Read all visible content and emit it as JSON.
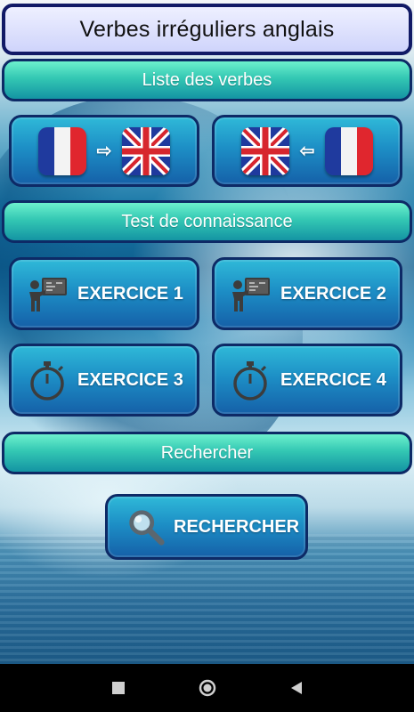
{
  "app": {
    "title": "Verbes irréguliers anglais"
  },
  "sections": {
    "list": "Liste des verbes",
    "test": "Test de connaissance",
    "search": "Rechercher"
  },
  "translation": {
    "fr_to_en": {
      "from": "flag-france-icon",
      "to": "flag-uk-icon",
      "arrow": "⇨"
    },
    "en_to_fr": {
      "from": "flag-uk-icon",
      "to": "flag-france-icon",
      "arrow": "⇦"
    }
  },
  "exercises": [
    {
      "label": "EXERCICE 1",
      "icon": "teacher-board-icon"
    },
    {
      "label": "EXERCICE 2",
      "icon": "teacher-board-icon"
    },
    {
      "label": "EXERCICE 3",
      "icon": "stopwatch-icon"
    },
    {
      "label": "EXERCICE 4",
      "icon": "stopwatch-icon"
    }
  ],
  "search_button": {
    "label": "RECHERCHER",
    "icon": "magnifier-icon"
  },
  "nav": {
    "recents": "square-icon",
    "home": "circle-icon",
    "back": "triangle-icon"
  },
  "colors": {
    "title_bg": "#cfd4fb",
    "section_bg": "#33c7b3",
    "tile_bg": "#1d8fc6",
    "border": "#0d2a66"
  }
}
